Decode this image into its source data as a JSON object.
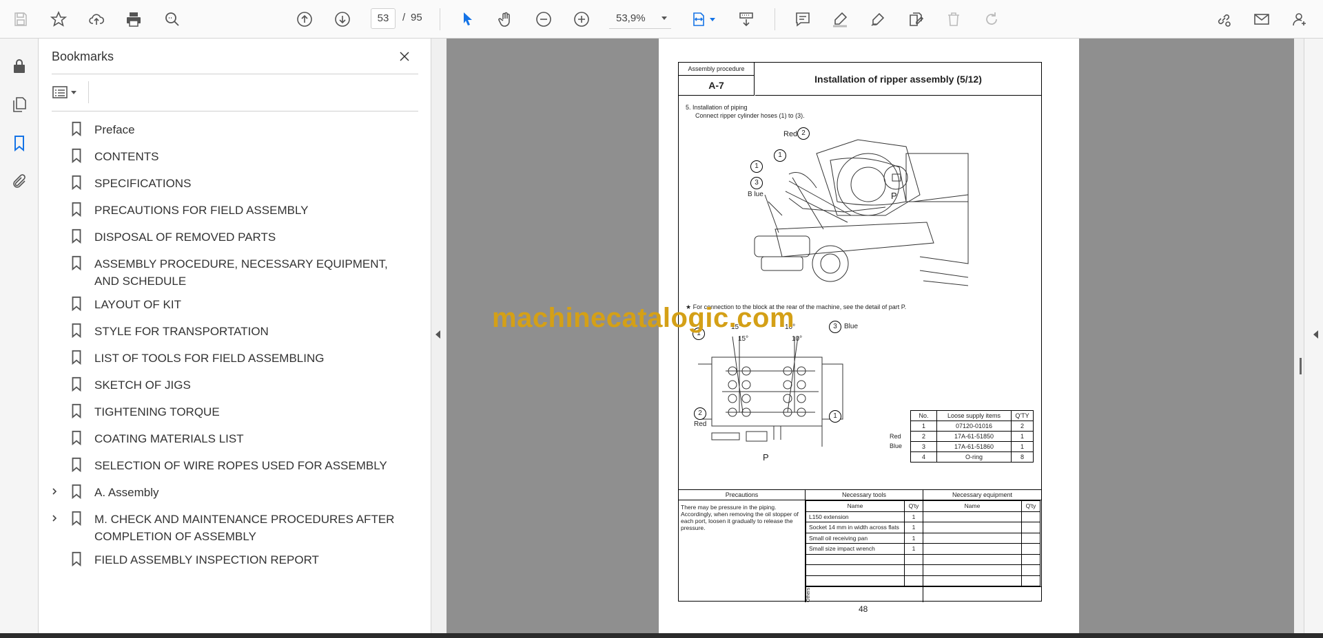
{
  "toolbar": {
    "current_page": "53",
    "page_sep": "/",
    "total_pages": "95",
    "zoom": "53,9%"
  },
  "bookmarks": {
    "title": "Bookmarks",
    "items": [
      {
        "label": "Preface",
        "expandable": false
      },
      {
        "label": "CONTENTS",
        "expandable": false
      },
      {
        "label": "SPECIFICATIONS",
        "expandable": false
      },
      {
        "label": "PRECAUTIONS FOR FIELD ASSEMBLY",
        "expandable": false
      },
      {
        "label": "DISPOSAL OF REMOVED PARTS",
        "expandable": false
      },
      {
        "label": "ASSEMBLY PROCEDURE, NECESSARY EQUIPMENT, AND SCHEDULE",
        "expandable": false
      },
      {
        "label": "LAYOUT OF KIT",
        "expandable": false
      },
      {
        "label": "STYLE FOR TRANSPORTATION",
        "expandable": false
      },
      {
        "label": "LIST OF TOOLS FOR FIELD ASSEMBLING",
        "expandable": false
      },
      {
        "label": "SKETCH OF JIGS",
        "expandable": false
      },
      {
        "label": "TIGHTENING TORQUE",
        "expandable": false
      },
      {
        "label": "COATING MATERIALS LIST",
        "expandable": false
      },
      {
        "label": "SELECTION OF WIRE ROPES USED FOR ASSEMBLY",
        "expandable": false
      },
      {
        "label": "A. Assembly",
        "expandable": true
      },
      {
        "label": "M. CHECK AND MAINTENANCE PROCEDURES AFTER COMPLETION OF ASSEMBLY",
        "expandable": true
      },
      {
        "label": "FIELD ASSEMBLY INSPECTION REPORT",
        "expandable": false
      }
    ]
  },
  "document": {
    "header_label": "Assembly procedure",
    "header_code": "A-7",
    "header_title": "Installation of ripper assembly (5/12)",
    "step_line1": "5.   Installation of piping",
    "step_line2": "Connect ripper cylinder hoses (1) to (3).",
    "note": "★   For connection to the block at the rear of the machine, see the detail of part P.",
    "fig1_labels": {
      "red": "Red",
      "blue": "B lue",
      "p": "P",
      "n1": "1",
      "n2": "2",
      "n3": "3"
    },
    "fig2_labels": {
      "red": "Red",
      "blue": "Blue",
      "p": "P",
      "a15a": "15°",
      "a15b": "15°",
      "a10a": "10°",
      "a10b": "10°",
      "n1": "1",
      "n2": "2",
      "n3": "3"
    },
    "supply_table": {
      "headers": [
        "No.",
        "Loose supply items",
        "Q'TY"
      ],
      "rows": [
        [
          "1",
          "07120-01016",
          "2"
        ],
        [
          "2",
          "17A-61-51850",
          "1"
        ],
        [
          "3",
          "17A-61-51860",
          "1"
        ],
        [
          "4",
          "O-ring",
          "8"
        ]
      ],
      "row_colors": {
        "red": "Red",
        "blue": "Blue"
      }
    },
    "precautions_head": "Precautions",
    "precautions_text": "There may be pressure in the piping. Accordingly, when removing the oil stopper of each port, loosen it gradually to release the pressure.",
    "tools_head": "Necessary tools",
    "equip_head": "Necessary equipment",
    "col_name": "Name",
    "col_qty": "Q'ty",
    "tools": [
      [
        "L150 extension",
        "1"
      ],
      [
        "Socket 14 mm in width across flats",
        "1"
      ],
      [
        "Small oil receiving pan",
        "1"
      ],
      [
        "Small size impact wrench",
        "1"
      ]
    ],
    "others": "Others",
    "page_number": "48"
  },
  "watermark": "machinecatalogic.com",
  "colors": {
    "accent": "#1473e6",
    "watermark": "#d4a017",
    "canvas": "#8f8f8f"
  }
}
